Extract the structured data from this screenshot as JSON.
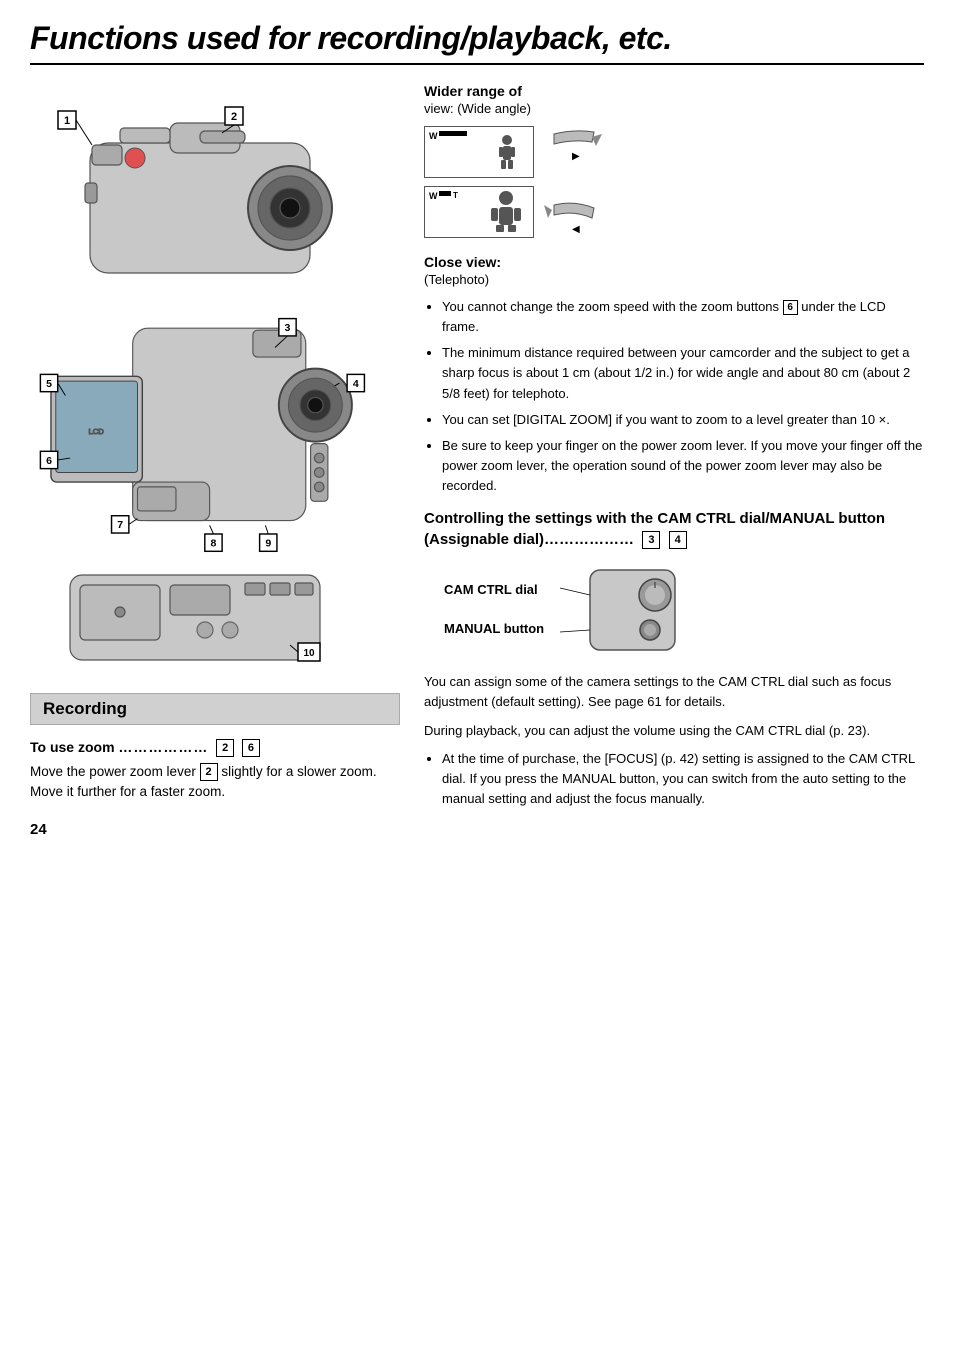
{
  "page": {
    "title": "Functions used for recording/playback, etc.",
    "page_number": "24"
  },
  "right_col": {
    "wider_range_title": "Wider range of",
    "wider_range_sub": "view: (Wide angle)",
    "close_view_title": "Close view:",
    "close_view_sub": "(Telephoto)",
    "bullets": [
      "You cannot change the zoom speed with the zoom buttons 6 under the LCD frame.",
      "The minimum distance required between your camcorder and the subject to get a sharp focus is about 1 cm (about 1/2 in.) for wide angle and about 80 cm (about 2 5/8 feet) for telephoto.",
      "You can set [DIGITAL ZOOM] if you want to zoom to a level greater than 10 ×.",
      "Be sure to keep your finger on the power zoom lever. If you move your finger off the power zoom lever, the operation sound of the power zoom lever may also be recorded."
    ],
    "ctrl_heading": "Controlling the settings with the CAM CTRL dial/MANUAL button (Assignable dial)………………",
    "ctrl_badge1": "3",
    "ctrl_badge2": "4",
    "cam_ctrl_label1": "CAM CTRL\ndial",
    "cam_ctrl_label2": "MANUAL\nbutton",
    "ctrl_body1": "You can assign some of the camera settings to the CAM CTRL dial such as focus adjustment (default setting). See page 61 for details.",
    "ctrl_body2": "During playback, you can adjust the volume using the CAM CTRL dial (p. 23).",
    "ctrl_bullet": "At the time of purchase, the [FOCUS] (p. 42) setting is assigned to the CAM CTRL dial. If you press the MANUAL button, you can switch from the auto setting to the manual setting and adjust the focus manually."
  },
  "recording": {
    "section_label": "Recording",
    "zoom_title": "To use zoom",
    "zoom_dots": "………………",
    "zoom_badge1": "2",
    "zoom_badge2": "6",
    "zoom_body": "Move the power zoom lever 2 slightly for a slower zoom. Move it further for a faster zoom."
  },
  "badges": {
    "1": "1",
    "2": "2",
    "3": "3",
    "4": "4",
    "5": "5",
    "6": "6",
    "7": "7",
    "8": "8",
    "9": "9",
    "10": "10"
  }
}
